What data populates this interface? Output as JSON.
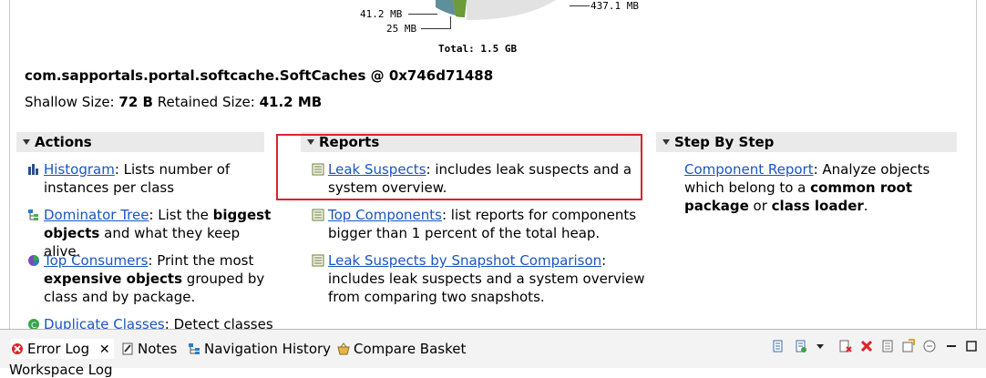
{
  "chart": {
    "labels": {
      "l1": "41.2 MB",
      "l2": "25 MB",
      "r1": "437.1 MB",
      "total": "Total: 1.5 GB"
    }
  },
  "object": {
    "title": "com.sapportals.portal.softcache.SoftCaches @ 0x746d71488",
    "shallow_label": "Shallow Size:",
    "shallow_value": "72 B",
    "retained_label": "Retained Size:",
    "retained_value": "41.2 MB"
  },
  "sections": {
    "actions": {
      "title": "Actions",
      "histogram": {
        "link": "Histogram",
        "text1": ": Lists number of",
        "text2": "instances per class"
      },
      "dominator": {
        "link": "Dominator Tree",
        "text1": ": List the ",
        "bold1": "biggest",
        "bold2": "objects",
        "text2": " and what they keep alive."
      },
      "consumers": {
        "link": "Top Consumers",
        "text1": ": Print the most",
        "bold1": "expensive objects",
        "text2": " grouped by",
        "text3": "class and by package."
      },
      "duplicates": {
        "link": "Duplicate Classes",
        "text1": ": Detect classes"
      }
    },
    "reports": {
      "title": "Reports",
      "leak": {
        "link": "Leak Suspects",
        "text1": ": includes leak suspects and a",
        "text2": "system overview."
      },
      "top": {
        "link": "Top Components",
        "text1": ": list reports for components",
        "text2": "bigger than 1 percent of the total heap."
      },
      "compare": {
        "link": "Leak Suspects by Snapshot Comparison",
        "text1": ":",
        "text2": "includes leak suspects and a system overview",
        "text3": "from comparing two snapshots."
      }
    },
    "step": {
      "title": "Step By Step",
      "component": {
        "link": "Component Report",
        "text1": ": Analyze objects",
        "text2": "which belong to a ",
        "bold1": "common root",
        "bold2": "package",
        "text3": " or ",
        "bold3": "class loader",
        "text4": "."
      }
    }
  },
  "tabs": {
    "error_log": "Error Log",
    "notes": "Notes",
    "nav_history": "Navigation History",
    "compare_basket": "Compare Basket"
  },
  "workspace_log": "Workspace Log",
  "colors": {
    "link": "#1a55c2",
    "highlight": "#d9252a",
    "pie_gray": "#e2e2e2",
    "pie_teal": "#5f8f9a",
    "pie_green": "#6d9a3a"
  }
}
